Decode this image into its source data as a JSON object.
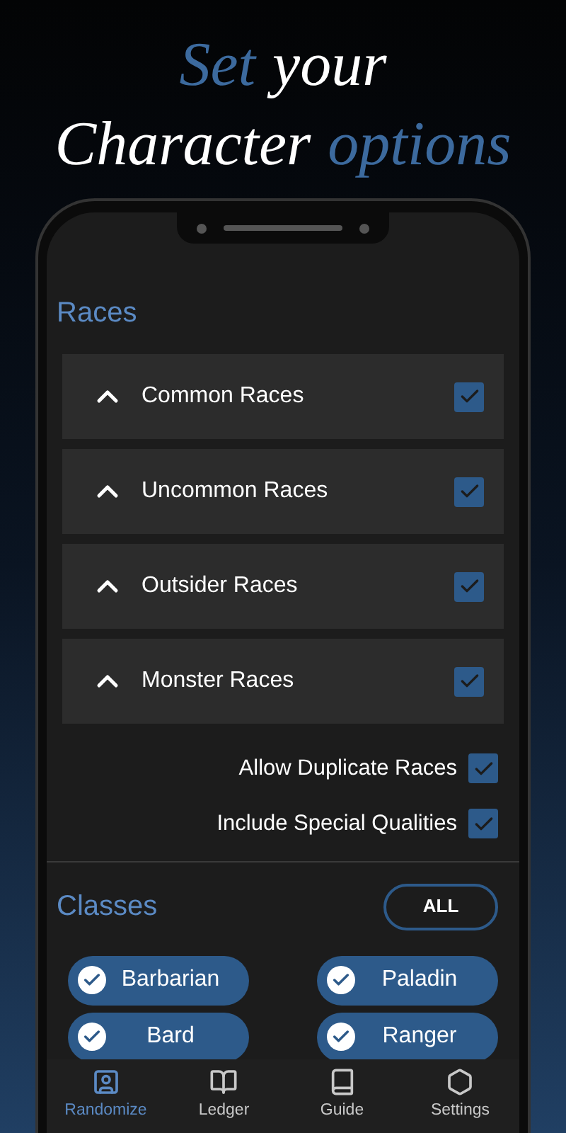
{
  "headline": [
    [
      {
        "text": "Set",
        "accent": true
      },
      {
        "text": "your",
        "accent": false
      }
    ],
    [
      {
        "text": "Character",
        "accent": false
      },
      {
        "text": "options",
        "accent": true
      }
    ]
  ],
  "races": {
    "title": "Races",
    "groups": [
      {
        "label": "Common Races",
        "expanded": false,
        "checked": true
      },
      {
        "label": "Uncommon Races",
        "expanded": false,
        "checked": true
      },
      {
        "label": "Outsider Races",
        "expanded": false,
        "checked": true
      },
      {
        "label": "Monster Races",
        "expanded": false,
        "checked": true
      }
    ],
    "options": [
      {
        "label": "Allow Duplicate Races",
        "checked": true
      },
      {
        "label": "Include Special Qualities",
        "checked": true
      }
    ]
  },
  "classes": {
    "title": "Classes",
    "all_button": "ALL",
    "items": [
      {
        "label": "Barbarian",
        "selected": true
      },
      {
        "label": "Paladin",
        "selected": true
      },
      {
        "label": "Bard",
        "selected": true
      },
      {
        "label": "Ranger",
        "selected": true
      }
    ]
  },
  "nav": [
    {
      "label": "Randomize",
      "selected": true
    },
    {
      "label": "Ledger",
      "selected": false
    },
    {
      "label": "Guide",
      "selected": false
    },
    {
      "label": "Settings",
      "selected": false
    }
  ]
}
